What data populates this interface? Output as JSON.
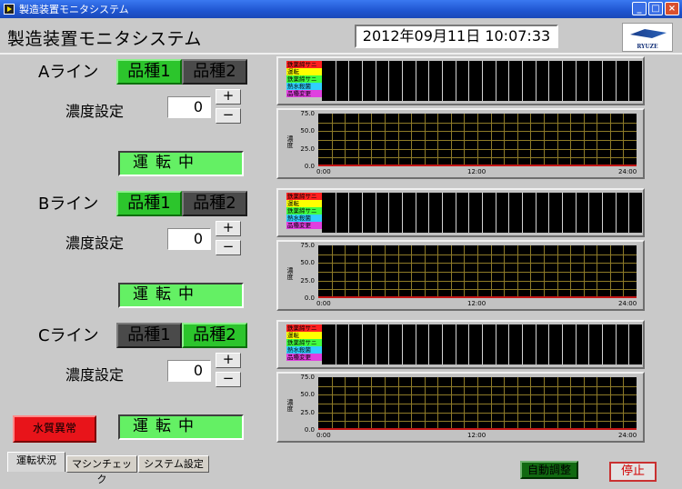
{
  "window": {
    "title": "製造装置モニタシステム",
    "app_icon": "labview-run-icon"
  },
  "header": {
    "app_title": "製造装置モニタシステム",
    "datetime": "2012年09月11日  10:07:33",
    "logo_text": "RYUZE"
  },
  "concentration_label": "濃度設定",
  "lines": [
    {
      "name": "Aライン",
      "product1": "品種1",
      "product2": "品種2",
      "selected_product": 1,
      "concentration": "0",
      "plus": "+",
      "minus": "−",
      "status": "運転中",
      "legend": [
        "鉄薬締サニ",
        "運転",
        "鉄薬締サニ",
        "熱水殺菌",
        "品種変更"
      ],
      "y_axis_label": "濃度",
      "y_ticks": [
        "75.0",
        "50.0",
        "25.0",
        "0.0"
      ],
      "x_ticks": [
        "0:00",
        "12:00",
        "24:00"
      ]
    },
    {
      "name": "Bライン",
      "product1": "品種1",
      "product2": "品種2",
      "selected_product": 1,
      "concentration": "0",
      "plus": "+",
      "minus": "−",
      "status": "運転中",
      "legend": [
        "鉄薬締サニ",
        "運転",
        "鉄薬締サニ",
        "熱水殺菌",
        "品種変更"
      ],
      "y_axis_label": "濃度",
      "y_ticks": [
        "75.0",
        "50.0",
        "25.0",
        "0.0"
      ],
      "x_ticks": [
        "0:00",
        "12:00",
        "24:00"
      ]
    },
    {
      "name": "Cライン",
      "product1": "品種1",
      "product2": "品種2",
      "selected_product": 2,
      "concentration": "0",
      "plus": "+",
      "minus": "−",
      "status": "運転中",
      "legend": [
        "鉄薬締サニ",
        "運転",
        "鉄薬締サニ",
        "熱水殺菌",
        "品種変更"
      ],
      "y_axis_label": "濃度",
      "y_ticks": [
        "75.0",
        "50.0",
        "25.0",
        "0.0"
      ],
      "x_ticks": [
        "0:00",
        "12:00",
        "24:00"
      ]
    }
  ],
  "legend_colors": [
    "#ff2020",
    "#ffff00",
    "#40ff40",
    "#30d0ff",
    "#e040e0"
  ],
  "alarm_label": "水質異常",
  "tabs": [
    "運転状況",
    "マシンチェック",
    "システム設定"
  ],
  "active_tab": 0,
  "auto_adjust_label": "自動調整",
  "stop_label": "停止",
  "colors": {
    "status_green": "#64f064",
    "product_on": "#2cc52c",
    "product_off": "#4a4a4a",
    "alarm_red": "#e8141a",
    "chart_grid": "#8e7b28",
    "chart_bg": "#000000"
  }
}
